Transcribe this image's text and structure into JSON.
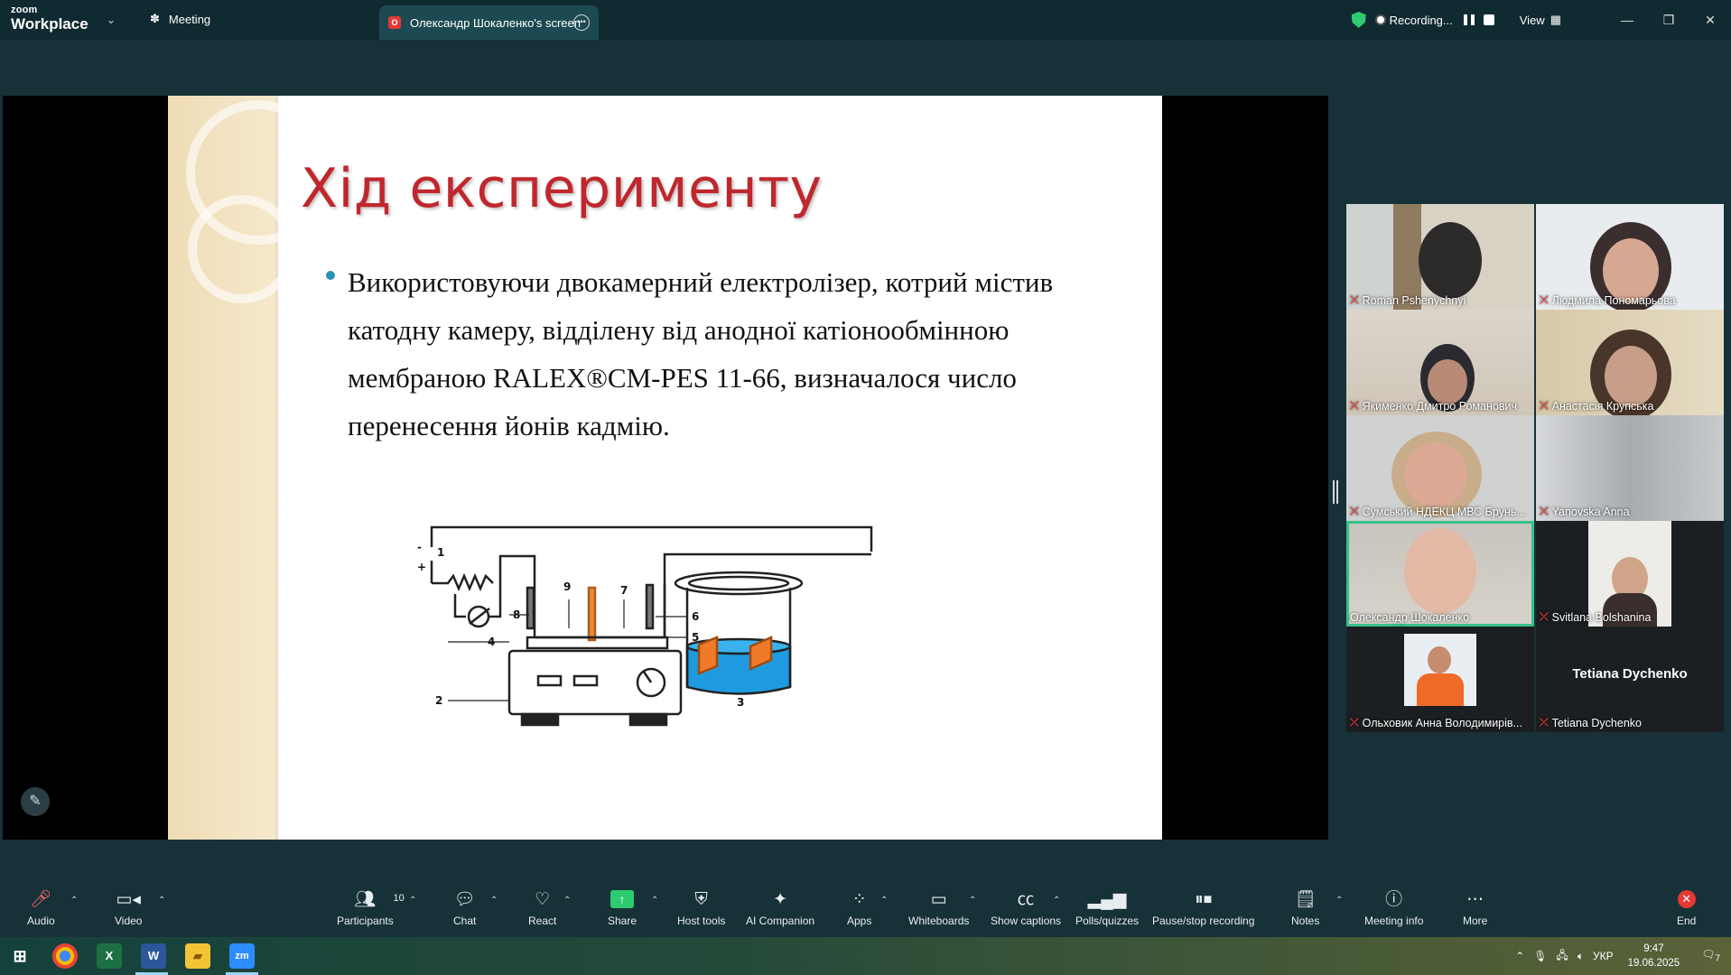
{
  "titlebar": {
    "brand_top": "zoom",
    "brand_bottom": "Workplace",
    "tab_meeting": "Meeting",
    "tab_screen": "Олександр Шокаленко's screen",
    "recording_label": "Recording...",
    "view_label": "View"
  },
  "slide": {
    "title": "Хід експерименту",
    "body": "Використовуючи двокамерний електролізер, котрий містив катодну камеру, відділену від анодної катіонообмінною мембраною RALEX®CM-PES 11-66, визначалося число перенесення йонів кадмію.",
    "diagram_labels": [
      "-",
      "+",
      "1",
      "9",
      "7",
      "8",
      "6",
      "4",
      "5",
      "2",
      "3"
    ]
  },
  "participants": [
    {
      "name": "Roman Pshenychnyi",
      "muted": true
    },
    {
      "name": "Людмила Пономарьова",
      "muted": true
    },
    {
      "name": "Якименко Дмитро Романович",
      "muted": true
    },
    {
      "name": "Анастасія Крупська",
      "muted": true
    },
    {
      "name": "Сумський НДЕКЦ МВС Брунь...",
      "muted": true
    },
    {
      "name": "Yanovska Anna",
      "muted": true
    },
    {
      "name": "Олександр Шокаленко",
      "muted": false
    },
    {
      "name": "Svitlana Bolshanina",
      "muted": true
    },
    {
      "name": "Ольховик Анна Володимирів...",
      "muted": true
    },
    {
      "name": "Tetiana Dychenko",
      "muted": true
    }
  ],
  "no_video_name": "Tetiana Dychenko",
  "toolbar": {
    "audio": "Audio",
    "video": "Video",
    "participants": "Participants",
    "participants_count": "10",
    "chat": "Chat",
    "react": "React",
    "share": "Share",
    "host_tools": "Host tools",
    "ai_companion": "AI Companion",
    "apps": "Apps",
    "whiteboards": "Whiteboards",
    "show_captions": "Show captions",
    "polls": "Polls/quizzes",
    "pause_stop": "Pause/stop recording",
    "notes": "Notes",
    "meeting_info": "Meeting info",
    "more": "More",
    "end": "End"
  },
  "taskbar": {
    "lang": "УКР",
    "time": "9:47",
    "date": "19.06.2025",
    "notifications": "7"
  },
  "colors": {
    "accent_green": "#2ecc71",
    "record_red": "#e53935",
    "slide_title": "#c0272d",
    "active_speaker": "#35c18a"
  }
}
